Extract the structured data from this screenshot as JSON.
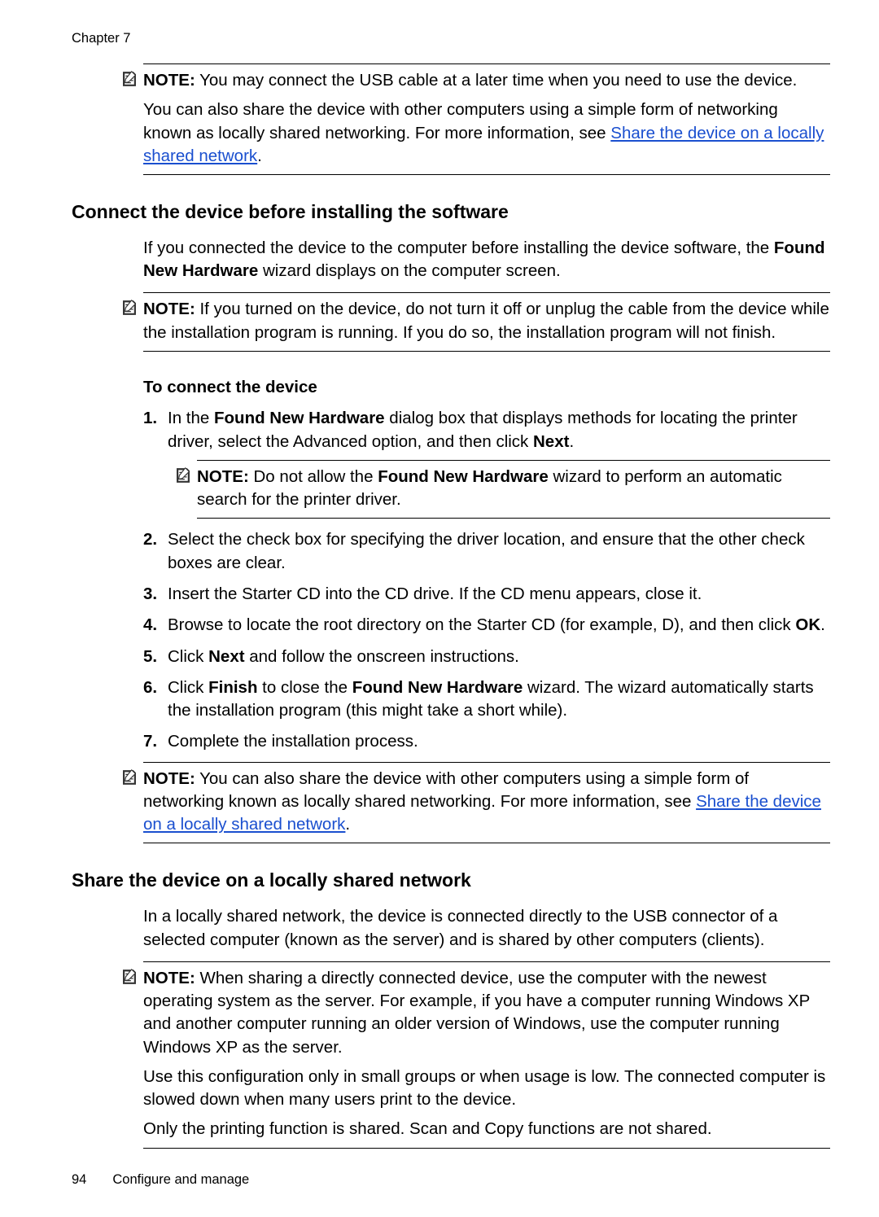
{
  "header": {
    "chapter": "Chapter 7"
  },
  "note1": {
    "label": "NOTE:",
    "p1a": "  You may connect the USB cable at a later time when you need to use the device.",
    "p2a": "You can also share the device with other computers using a simple form of networking known as locally shared networking. For more information, see ",
    "p2link": "Share the device on a locally shared network",
    "p2c": "."
  },
  "sectionA": {
    "title": "Connect the device before installing the software",
    "intro_a": "If you connected the device to the computer before installing the device software, the ",
    "intro_b": "Found New Hardware",
    "intro_c": " wizard displays on the computer screen."
  },
  "note2": {
    "label": "NOTE:",
    "text": "  If you turned on the device, do not turn it off or unplug the cable from the device while the installation program is running. If you do so, the installation program will not finish."
  },
  "procedure": {
    "heading": "To connect the device",
    "steps": [
      {
        "n": "1.",
        "pre": "In the ",
        "b1": "Found New Hardware",
        "mid": " dialog box that displays methods for locating the printer driver, select the Advanced option, and then click ",
        "b2": "Next",
        "post": "."
      },
      {
        "n": "2.",
        "text": "Select the check box for specifying the driver location, and ensure that the other check boxes are clear."
      },
      {
        "n": "3.",
        "text": "Insert the Starter CD into the CD drive. If the CD menu appears, close it."
      },
      {
        "n": "4.",
        "pre": "Browse to locate the root directory on the Starter CD (for example, D), and then click ",
        "b1": "OK",
        "post": "."
      },
      {
        "n": "5.",
        "pre": "Click ",
        "b1": "Next",
        "post": " and follow the onscreen instructions."
      },
      {
        "n": "6.",
        "pre": "Click ",
        "b1": "Finish",
        "mid": " to close the ",
        "b2": "Found New Hardware",
        "post": " wizard. The wizard automatically starts the installation program (this might take a short while)."
      },
      {
        "n": "7.",
        "text": "Complete the installation process."
      }
    ],
    "step1note": {
      "label": "NOTE:",
      "pre": "  Do not allow the ",
      "b": "Found New Hardware",
      "post": " wizard to perform an automatic search for the printer driver."
    }
  },
  "note3": {
    "label": "NOTE:",
    "pre": "  You can also share the device with other computers using a simple form of networking known as locally shared networking. For more information, see ",
    "link": "Share the device on a locally shared network",
    "post": "."
  },
  "sectionB": {
    "title": "Share the device on a locally shared network",
    "intro": "In a locally shared network, the device is connected directly to the USB connector of a selected computer (known as the server) and is shared by other computers (clients)."
  },
  "note4": {
    "label": "NOTE:",
    "p1": "  When sharing a directly connected device, use the computer with the newest operating system as the server. For example, if you have a computer running Windows XP and another computer running an older version of Windows, use the computer running Windows XP as the server.",
    "p2": "Use this configuration only in small groups or when usage is low. The connected computer is slowed down when many users print to the device.",
    "p3": "Only the printing function is shared. Scan and Copy functions are not shared."
  },
  "footer": {
    "page": "94",
    "section": "Configure and manage"
  }
}
